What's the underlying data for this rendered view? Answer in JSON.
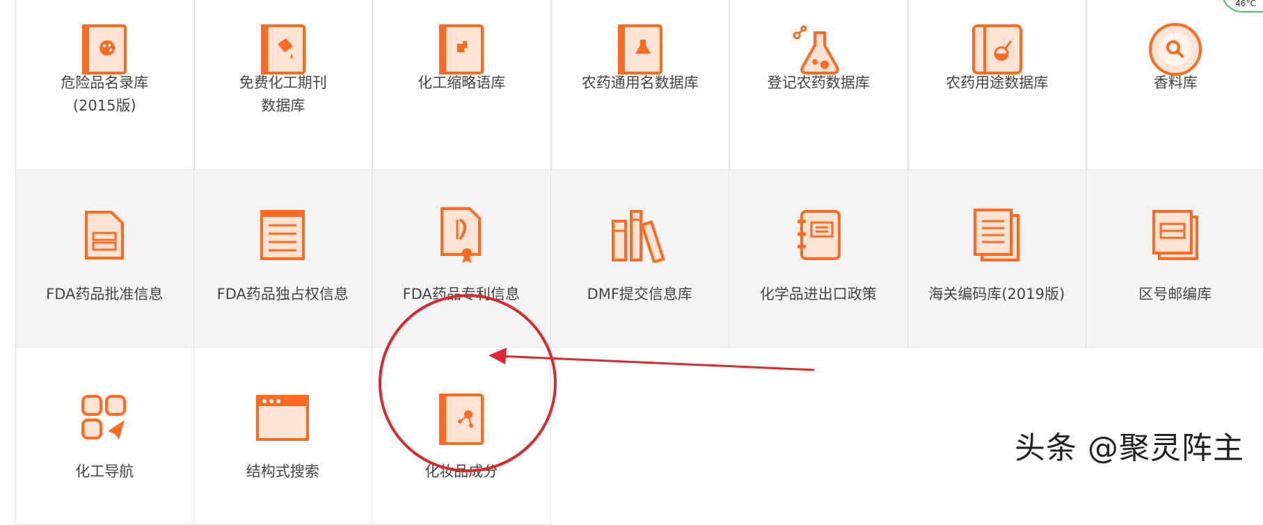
{
  "colors": {
    "accent": "#ff6a1f",
    "accent_light": "#ffe3d4",
    "annotation": "#e0262d"
  },
  "databases": [
    {
      "label": "危险品名录库\n(2015版)",
      "icon": "book-palette-icon"
    },
    {
      "label": "免费化工期刊\n数据库",
      "icon": "book-paint-bucket-icon"
    },
    {
      "label": "化工缩略语库",
      "icon": "book-puzzle-icon"
    },
    {
      "label": "农药通用名数据库",
      "icon": "book-flask-icon"
    },
    {
      "label": "登记农药数据库",
      "icon": "flask-molecule-icon"
    },
    {
      "label": "农药用途数据库",
      "icon": "book-beaker-icon"
    },
    {
      "label": "香料库",
      "icon": "magnifier-circle-icon"
    },
    {
      "label": "FDA药品批准信息",
      "icon": "document-icon"
    },
    {
      "label": "FDA药品独占权信息",
      "icon": "list-icon"
    },
    {
      "label": "FDA药品专利信息",
      "icon": "certificate-icon"
    },
    {
      "label": "DMF提交信息库",
      "icon": "books-shelf-icon"
    },
    {
      "label": "化学品进出口政策",
      "icon": "notebook-icon"
    },
    {
      "label": "海关编码库(2019版)",
      "icon": "stacked-documents-icon"
    },
    {
      "label": "区号邮编库",
      "icon": "cards-icon"
    },
    {
      "label": "化工导航",
      "icon": "app-grid-plane-icon"
    },
    {
      "label": "结构式搜索",
      "icon": "browser-window-icon"
    },
    {
      "label": "化妆品成分",
      "icon": "book-molecule-icon"
    }
  ],
  "watermark": "头条 @聚灵阵主",
  "badge": "46°C"
}
